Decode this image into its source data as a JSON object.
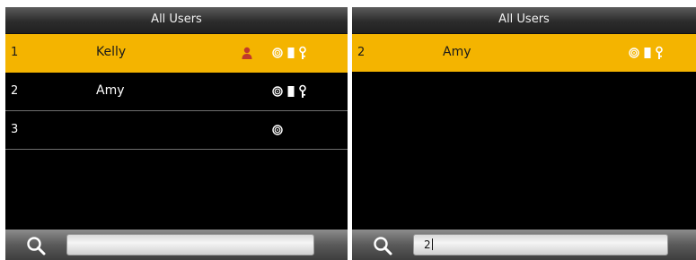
{
  "left_screen": {
    "title": "All Users",
    "users": [
      {
        "id": "1",
        "name": "Kelly",
        "selected": true,
        "icons": [
          "admin-user-icon",
          "fingerprint-icon",
          "card-icon",
          "password-key-icon"
        ]
      },
      {
        "id": "2",
        "name": "Amy",
        "selected": false,
        "icons": [
          "fingerprint-icon",
          "card-icon",
          "password-key-icon"
        ]
      },
      {
        "id": "3",
        "name": "",
        "selected": false,
        "icons": [
          "fingerprint-icon"
        ]
      }
    ],
    "search": {
      "icon": "search-icon",
      "value": ""
    }
  },
  "right_screen": {
    "title": "All Users",
    "users": [
      {
        "id": "2",
        "name": "Amy",
        "selected": true,
        "icons": [
          "fingerprint-icon",
          "card-icon",
          "password-key-icon"
        ]
      }
    ],
    "search": {
      "icon": "search-icon",
      "value": "2"
    }
  },
  "colors": {
    "selected_row": "#f4b400",
    "admin_icon": "#c0392b",
    "background": "#000000"
  }
}
